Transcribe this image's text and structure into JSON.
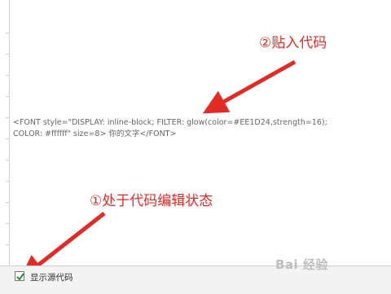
{
  "editor": {
    "code_line_1": "<FONT style=\"DISPLAY: inline-block; FILTER: glow(color=#EE1D24,strength=16);",
    "code_line_2": "COLOR: #ffffff\" size=8> 你的文字</FONT>"
  },
  "annotations": {
    "paste_code": "②贴入代码",
    "code_edit_state": "①处于代码编辑状态"
  },
  "bottom": {
    "show_source_label": "显示源代码",
    "show_source_checked": true
  },
  "watermark": "Bai 经验",
  "colors": {
    "annotation": "#e32b26",
    "checkbox_check": "#2e8b2e"
  },
  "icons": [
    "check-icon",
    "arrow-icon"
  ]
}
